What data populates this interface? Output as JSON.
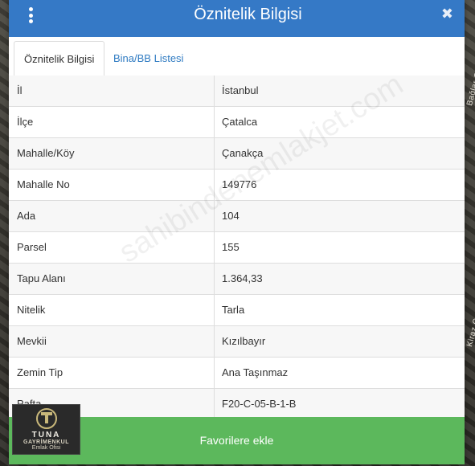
{
  "dialog": {
    "title": "Öznitelik Bilgisi",
    "close_glyph": "✖",
    "menu_icon": "vertical-dots-icon"
  },
  "tabs": [
    {
      "label": "Öznitelik Bilgisi",
      "active": true
    },
    {
      "label": "Bina/BB Listesi",
      "active": false
    }
  ],
  "rows": [
    {
      "key": "İl",
      "value": "İstanbul"
    },
    {
      "key": "İlçe",
      "value": "Çatalca"
    },
    {
      "key": "Mahalle/Köy",
      "value": "Çanakça"
    },
    {
      "key": "Mahalle No",
      "value": "149776"
    },
    {
      "key": "Ada",
      "value": "104"
    },
    {
      "key": "Parsel",
      "value": "155"
    },
    {
      "key": "Tapu Alanı",
      "value": "1.364,33"
    },
    {
      "key": "Nitelik",
      "value": "Tarla"
    },
    {
      "key": "Mevkii",
      "value": "Kızılbayır"
    },
    {
      "key": "Zemin Tip",
      "value": "Ana Taşınmaz"
    },
    {
      "key": "Pafta",
      "value": "F20-C-05-B-1-B"
    }
  ],
  "favorite_button": {
    "label": "Favorilere ekle"
  },
  "watermark": "sahibindenemlakjet.com",
  "map_labels": [
    "Bağlar C",
    "Kiraz C"
  ],
  "logo": {
    "name": "TUNA",
    "line2": "GAYRİMENKUL",
    "line3": "Emlak Ofisi"
  },
  "colors": {
    "header": "#3579c6",
    "favorite_button": "#5cb85c",
    "tab_link": "#2f7bc2"
  }
}
